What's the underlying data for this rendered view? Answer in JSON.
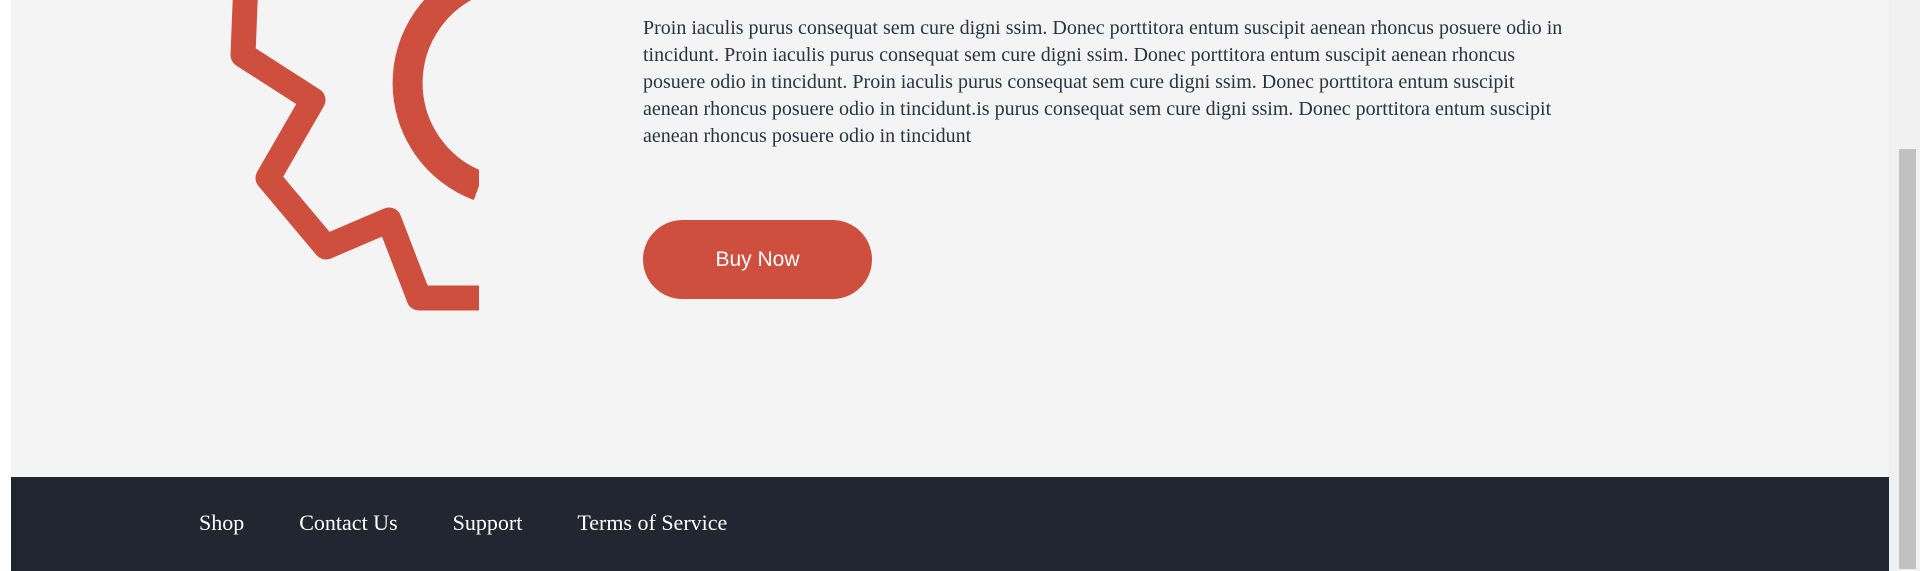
{
  "content": {
    "description": "Proin iaculis purus consequat sem cure digni ssim. Donec porttitora entum suscipit aenean rhoncus posuere odio in tincidunt. Proin iaculis purus consequat sem cure digni ssim. Donec porttitora entum suscipit aenean rhoncus posuere odio in tincidunt. Proin iaculis purus consequat sem cure digni ssim. Donec porttitora entum suscipit aenean rhoncus posuere odio in tincidunt.is purus consequat sem cure digni ssim. Donec porttitora entum suscipit aenean rhoncus posuere odio in tincidunt",
    "buy_label": "Buy Now",
    "graphic_icon": "gear-icon"
  },
  "footer": {
    "links": [
      {
        "label": "Shop"
      },
      {
        "label": "Contact Us"
      },
      {
        "label": "Support"
      },
      {
        "label": "Terms of Service"
      }
    ]
  },
  "colors": {
    "accent": "#cf4f3f",
    "background": "#f4f4f4",
    "footer": "#222630",
    "text": "#2b3240"
  }
}
